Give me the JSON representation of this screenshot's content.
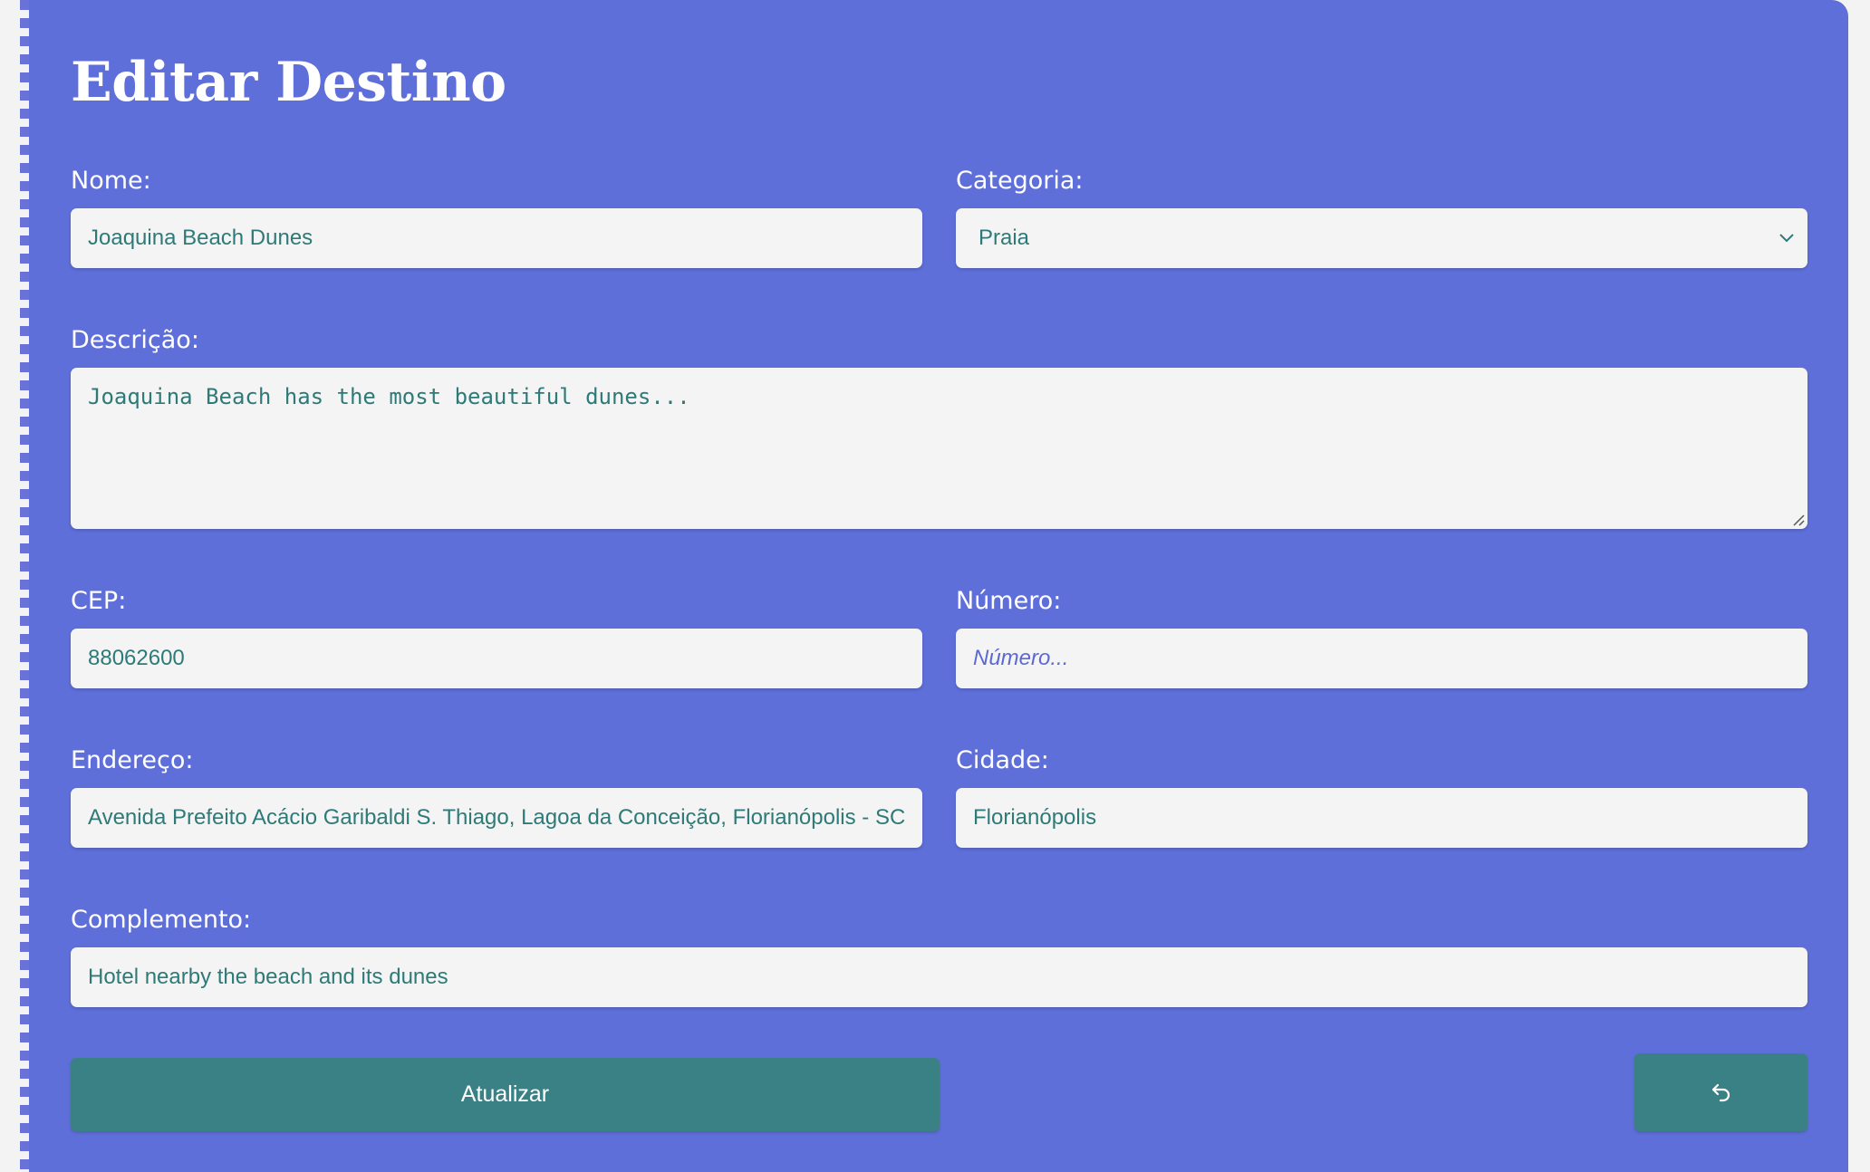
{
  "form": {
    "title": "Editar Destino",
    "nome": {
      "label": "Nome:",
      "value": "Joaquina Beach Dunes"
    },
    "categoria": {
      "label": "Categoria:",
      "value": "Praia"
    },
    "descricao": {
      "label": "Descrição:",
      "value": "Joaquina Beach has the most beautiful dunes..."
    },
    "cep": {
      "label": "CEP:",
      "value": "88062600"
    },
    "numero": {
      "label": "Número:",
      "placeholder": "Número..."
    },
    "endereco": {
      "label": "Endereço:",
      "value": "Avenida Prefeito Acácio Garibaldi S. Thiago, Lagoa da Conceição, Florianópolis - SC"
    },
    "cidade": {
      "label": "Cidade:",
      "value": "Florianópolis"
    },
    "complemento": {
      "label": "Complemento:",
      "value": "Hotel nearby the beach and its dunes"
    },
    "submit_label": "Atualizar",
    "back_icon": "undo-arrow-icon"
  },
  "colors": {
    "panel": "#5f6fd9",
    "field_bg": "#f4f4f4",
    "field_text": "#2e7a78",
    "button": "#3a8185"
  }
}
